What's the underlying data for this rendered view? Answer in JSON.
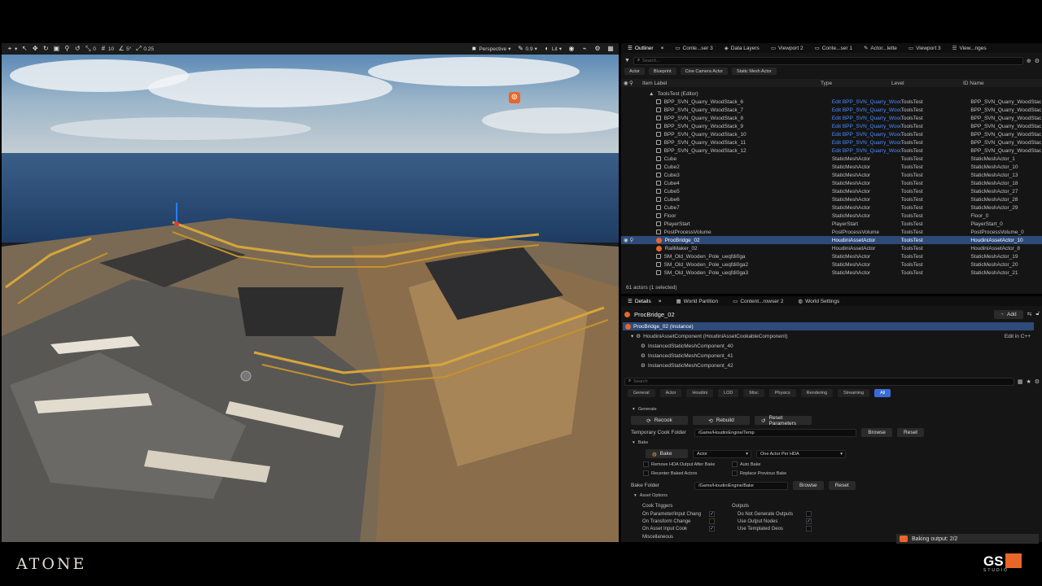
{
  "viewport": {
    "toolbar_left": [
      "0",
      "10",
      "5°",
      "0.25"
    ],
    "perspective": "Perspective",
    "fov": "0.9",
    "lit": "Lit"
  },
  "top_tabs": [
    {
      "label": "Outliner"
    },
    {
      "label": "Conte...ser 3"
    },
    {
      "label": "Data Layers"
    },
    {
      "label": "Viewport 2"
    },
    {
      "label": "Conte...ser 1"
    },
    {
      "label": "Actor...lette"
    },
    {
      "label": "Viewport 3"
    },
    {
      "label": "View...nges"
    }
  ],
  "outliner": {
    "search_placeholder": "Search...",
    "filters": [
      "Actor",
      "Blueprint",
      "Cine Camera Actor",
      "Static Mesh Actor"
    ],
    "columns": [
      "Item Label",
      "Type",
      "Level",
      "ID Name"
    ],
    "root": "ToolsTest (Editor)",
    "rows": [
      {
        "label": "BPP_SVN_Quarry_WoodStack_6",
        "type": "Edit BPP_SVN_Quarry_Wooc",
        "level": "ToolsTest",
        "id": "BPP_SVN_Quarry_WoodStac",
        "link": true
      },
      {
        "label": "BPP_SVN_Quarry_WoodStack_7",
        "type": "Edit BPP_SVN_Quarry_Wooc",
        "level": "ToolsTest",
        "id": "BPP_SVN_Quarry_WoodStac",
        "link": true
      },
      {
        "label": "BPP_SVN_Quarry_WoodStack_8",
        "type": "Edit BPP_SVN_Quarry_Wooc",
        "level": "ToolsTest",
        "id": "BPP_SVN_Quarry_WoodStac",
        "link": true
      },
      {
        "label": "BPP_SVN_Quarry_WoodStack_9",
        "type": "Edit BPP_SVN_Quarry_Wooc",
        "level": "ToolsTest",
        "id": "BPP_SVN_Quarry_WoodStac",
        "link": true
      },
      {
        "label": "BPP_SVN_Quarry_WoodStack_10",
        "type": "Edit BPP_SVN_Quarry_Wooc",
        "level": "ToolsTest",
        "id": "BPP_SVN_Quarry_WoodStac",
        "link": true
      },
      {
        "label": "BPP_SVN_Quarry_WoodStack_11",
        "type": "Edit BPP_SVN_Quarry_Wooc",
        "level": "ToolsTest",
        "id": "BPP_SVN_Quarry_WoodStac",
        "link": true
      },
      {
        "label": "BPP_SVN_Quarry_WoodStack_12",
        "type": "Edit BPP_SVN_Quarry_Wooc",
        "level": "ToolsTest",
        "id": "BPP_SVN_Quarry_WoodStac",
        "link": true
      },
      {
        "label": "Cube",
        "type": "StaticMeshActor",
        "level": "ToolsTest",
        "id": "StaticMeshActor_1"
      },
      {
        "label": "Cube2",
        "type": "StaticMeshActor",
        "level": "ToolsTest",
        "id": "StaticMeshActor_10"
      },
      {
        "label": "Cube3",
        "type": "StaticMeshActor",
        "level": "ToolsTest",
        "id": "StaticMeshActor_13"
      },
      {
        "label": "Cube4",
        "type": "StaticMeshActor",
        "level": "ToolsTest",
        "id": "StaticMeshActor_18"
      },
      {
        "label": "Cube5",
        "type": "StaticMeshActor",
        "level": "ToolsTest",
        "id": "StaticMeshActor_27"
      },
      {
        "label": "Cube6",
        "type": "StaticMeshActor",
        "level": "ToolsTest",
        "id": "StaticMeshActor_28"
      },
      {
        "label": "Cube7",
        "type": "StaticMeshActor",
        "level": "ToolsTest",
        "id": "StaticMeshActor_29"
      },
      {
        "label": "Floor",
        "type": "StaticMeshActor",
        "level": "ToolsTest",
        "id": "Floor_0"
      },
      {
        "label": "PlayerStart",
        "type": "PlayerStart",
        "level": "ToolsTest",
        "id": "PlayerStart_0"
      },
      {
        "label": "PostProcessVolume",
        "type": "PostProcessVolume",
        "level": "ToolsTest",
        "id": "PostProcessVolume_0"
      },
      {
        "label": "ProcBridge_02",
        "type": "HoudiniAssetActor",
        "level": "ToolsTest",
        "id": "HoudiniAssetActor_10",
        "selected": true
      },
      {
        "label": "RailMaker_02",
        "type": "HoudiniAssetActor",
        "level": "ToolsTest",
        "id": "HoudiniAssetActor_8"
      },
      {
        "label": "SM_Old_Wooden_Pole_ueqfdi0ga",
        "type": "StaticMeshActor",
        "level": "ToolsTest",
        "id": "StaticMeshActor_19"
      },
      {
        "label": "SM_Old_Wooden_Pole_ueqfdi0ga2",
        "type": "StaticMeshActor",
        "level": "ToolsTest",
        "id": "StaticMeshActor_20"
      },
      {
        "label": "SM_Old_Wooden_Pole_ueqfdi0ga3",
        "type": "StaticMeshActor",
        "level": "ToolsTest",
        "id": "StaticMeshActor_21"
      }
    ],
    "status": "61 actors (1 selected)"
  },
  "details_tabs": [
    {
      "label": "Details"
    },
    {
      "label": "World Partition"
    },
    {
      "label": "Content...rowser 2"
    },
    {
      "label": "World Settings"
    }
  ],
  "details": {
    "title": "ProcBridge_02",
    "add_label": "Add",
    "instance": "ProcBridge_02 (Instance)",
    "component": "HoudiniAssetComponent (HoudiniAssetCookableComponent)",
    "edit_cpp": "Edit in C++",
    "subcomponents": [
      "InstancedStaticMeshComponent_40",
      "InstancedStaticMeshComponent_41",
      "InstancedStaticMeshComponent_42"
    ],
    "search_placeholder": "Search",
    "categories": [
      "General",
      "Actor",
      "Houdini",
      "LOD",
      "Misc",
      "Physics",
      "Rendering",
      "Streaming",
      "All"
    ],
    "generate": "Generate",
    "recook": "Recook",
    "rebuild": "Rebuild",
    "reset_params": "Reset Parameters",
    "temp_folder_label": "Temporary Cook Folder",
    "temp_folder": "/Game/HoudiniEngine/Temp",
    "browse": "Browse",
    "reset": "Reset",
    "bake_section": "Bake",
    "bake_btn": "Bake",
    "bake_type": "Actor",
    "bake_mode": "One Actor Per HDA",
    "remove_hda": "Remove HDA Output After Bake",
    "auto_bake": "Auto Bake",
    "recenter": "Recenter Baked Actors",
    "replace_prev": "Replace Previous Bake",
    "bake_folder_label": "Bake Folder",
    "bake_folder": "/Game/HoudiniEngine/Bake",
    "asset_options": "Asset Options",
    "cook_triggers": "Cook Triggers",
    "outputs": "Outputs",
    "on_param": "On Parameter/Input Chang",
    "on_transform": "On Transform Change",
    "on_asset_input": "On Asset Input Cook",
    "no_gen_outputs": "Do Not Generate Outputs",
    "use_output_nodes": "Use Output Nodes",
    "use_templated": "Use Templated Geos",
    "misc": "Miscellaneous",
    "baking_output": "Baking output: 2/2"
  },
  "branding": {
    "left_logo": "ATONE",
    "right_logo": "GS",
    "right_sub": "STUDIO"
  }
}
